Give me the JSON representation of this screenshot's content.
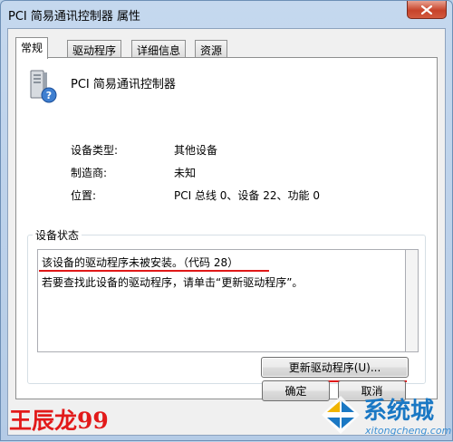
{
  "window": {
    "title": "PCI 简易通讯控制器 属性"
  },
  "tabs": [
    {
      "label": "常规",
      "active": true
    },
    {
      "label": "驱动程序",
      "active": false
    },
    {
      "label": "详细信息",
      "active": false
    },
    {
      "label": "资源",
      "active": false
    }
  ],
  "device": {
    "name": "PCI 简易通讯控制器",
    "icon": "device-unknown-icon",
    "properties": [
      {
        "label": "设备类型:",
        "value": "其他设备"
      },
      {
        "label": "制造商:",
        "value": "未知"
      },
      {
        "label": "位置:",
        "value": "PCI 总线 0、设备 22、功能 0"
      }
    ]
  },
  "status": {
    "group_label": "设备状态",
    "line1": "该设备的驱动程序未被安装。（代码 28）",
    "line2": "若要查找此设备的驱动程序，请单击“更新驱动程序”。",
    "update_button": "更新驱动程序(U)..."
  },
  "footer": {
    "ok_label": "确定",
    "cancel_label": "取消"
  },
  "overlay": {
    "signature": "王辰龙99",
    "watermark_text": "系统城",
    "watermark_url": "xitongcheng.com"
  },
  "colors": {
    "annotation_red": "#e01818",
    "watermark_blue": "#1a78c4"
  }
}
